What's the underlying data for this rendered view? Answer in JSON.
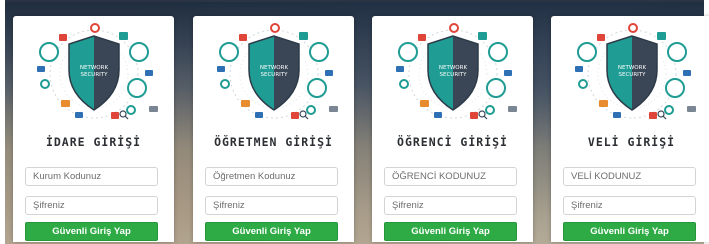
{
  "cards": [
    {
      "title": "İDARE GİRİŞİ",
      "field1_placeholder": "Kurum Kodunuz",
      "field2_placeholder": "Şifreniz",
      "button_label": "Güvenli Giriş Yap",
      "illustration_text": "NETWORK\nSECURITY"
    },
    {
      "title": "ÖĞRETMEN GİRİŞİ",
      "field1_placeholder": "Öğretmen Kodunuz",
      "field2_placeholder": "Şifreniz",
      "button_label": "Güvenli Giriş Yap",
      "illustration_text": "NETWORK\nSECURITY"
    },
    {
      "title": "ÖĞRENCİ GİRİŞİ",
      "field1_placeholder": "ÖĞRENCİ KODUNUZ",
      "field2_placeholder": "Şifreniz",
      "button_label": "Güvenli Giriş Yap",
      "illustration_text": "NETWORK\nSECURITY"
    },
    {
      "title": "VELİ GİRİŞİ",
      "field1_placeholder": "VELİ KODUNUZ",
      "field2_placeholder": "Şifreniz",
      "button_label": "Güvenli Giriş Yap",
      "illustration_text": "NETWORK\nSECURITY"
    }
  ],
  "colors": {
    "button_green": "#2eab45",
    "shield_teal": "#1f9c93",
    "shield_dark": "#3a4656"
  },
  "icons": [
    "network-security-shield-icon"
  ]
}
